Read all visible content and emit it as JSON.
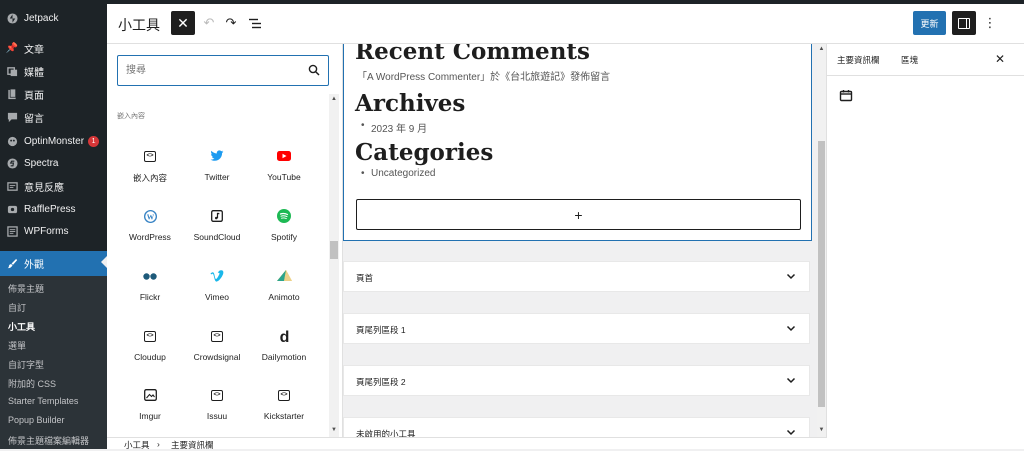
{
  "admin_menu": {
    "items": [
      {
        "label": "Jetpack",
        "icon": "jetpack-icon"
      },
      {
        "label": "文章",
        "icon": "pin-icon"
      },
      {
        "label": "媒體",
        "icon": "media-icon"
      },
      {
        "label": "頁面",
        "icon": "page-icon"
      },
      {
        "label": "留言",
        "icon": "comment-icon"
      },
      {
        "label": "OptinMonster",
        "icon": "optinmonster-icon",
        "badge": "1"
      },
      {
        "label": "Spectra",
        "icon": "spectra-icon"
      },
      {
        "label": "意見反應",
        "icon": "feedback-icon"
      },
      {
        "label": "RafflePress",
        "icon": "rafflepress-icon"
      },
      {
        "label": "WPForms",
        "icon": "wpforms-icon"
      },
      {
        "label": "外觀",
        "icon": "appearance-icon",
        "current": true
      }
    ],
    "submenu": [
      "佈景主題",
      "自訂",
      "小工具",
      "選單",
      "自訂字型",
      "附加的 CSS",
      "Starter Templates",
      "Popup Builder",
      "佈景主題檔案編輯器"
    ],
    "submenu_current": "小工具"
  },
  "header": {
    "title": "小工具",
    "update_label": "更新"
  },
  "inserter": {
    "search_placeholder": "搜尋",
    "category": "嵌入內容",
    "blocks": [
      {
        "label": "嵌入內容",
        "icon": "embed-icon"
      },
      {
        "label": "Twitter",
        "icon": "twitter-icon"
      },
      {
        "label": "YouTube",
        "icon": "youtube-icon"
      },
      {
        "label": "WordPress",
        "icon": "wordpress-icon"
      },
      {
        "label": "SoundCloud",
        "icon": "soundcloud-icon"
      },
      {
        "label": "Spotify",
        "icon": "spotify-icon"
      },
      {
        "label": "Flickr",
        "icon": "flickr-icon"
      },
      {
        "label": "Vimeo",
        "icon": "vimeo-icon"
      },
      {
        "label": "Animoto",
        "icon": "animoto-icon"
      },
      {
        "label": "Cloudup",
        "icon": "cloudup-icon"
      },
      {
        "label": "Crowdsignal",
        "icon": "crowdsignal-icon"
      },
      {
        "label": "Dailymotion",
        "icon": "dailymotion-icon"
      },
      {
        "label": "Imgur",
        "icon": "imgur-icon"
      },
      {
        "label": "Issuu",
        "icon": "issuu-icon"
      },
      {
        "label": "Kickstarter",
        "icon": "kickstarter-icon"
      }
    ]
  },
  "canvas": {
    "recent_comments_heading": "Recent Comments",
    "comment_line": "「A WordPress Commenter」於《台北旅遊記》發佈留言",
    "archives_heading": "Archives",
    "archives_items": [
      "2023 年 9 月"
    ],
    "categories_heading": "Categories",
    "categories_items": [
      "Uncategorized"
    ],
    "append_label": "+",
    "widget_areas": [
      "頁首",
      "頁尾列區段 1",
      "頁尾列區段 2",
      "未啟用的小工具"
    ]
  },
  "settings_sidebar": {
    "tabs": [
      "主要資訊欄",
      "區塊"
    ]
  },
  "breadcrumb": [
    "小工具",
    "主要資訊欄"
  ],
  "colors": {
    "accent": "#2271b1",
    "admin_bg": "#1d2327",
    "twitter": "#1d9bf0",
    "youtube": "#ff0000",
    "spotify": "#1db954",
    "vimeo": "#1ab7ea",
    "wordpress": "#3582c4",
    "flickr": "#0063dc",
    "badge": "#d63638"
  }
}
